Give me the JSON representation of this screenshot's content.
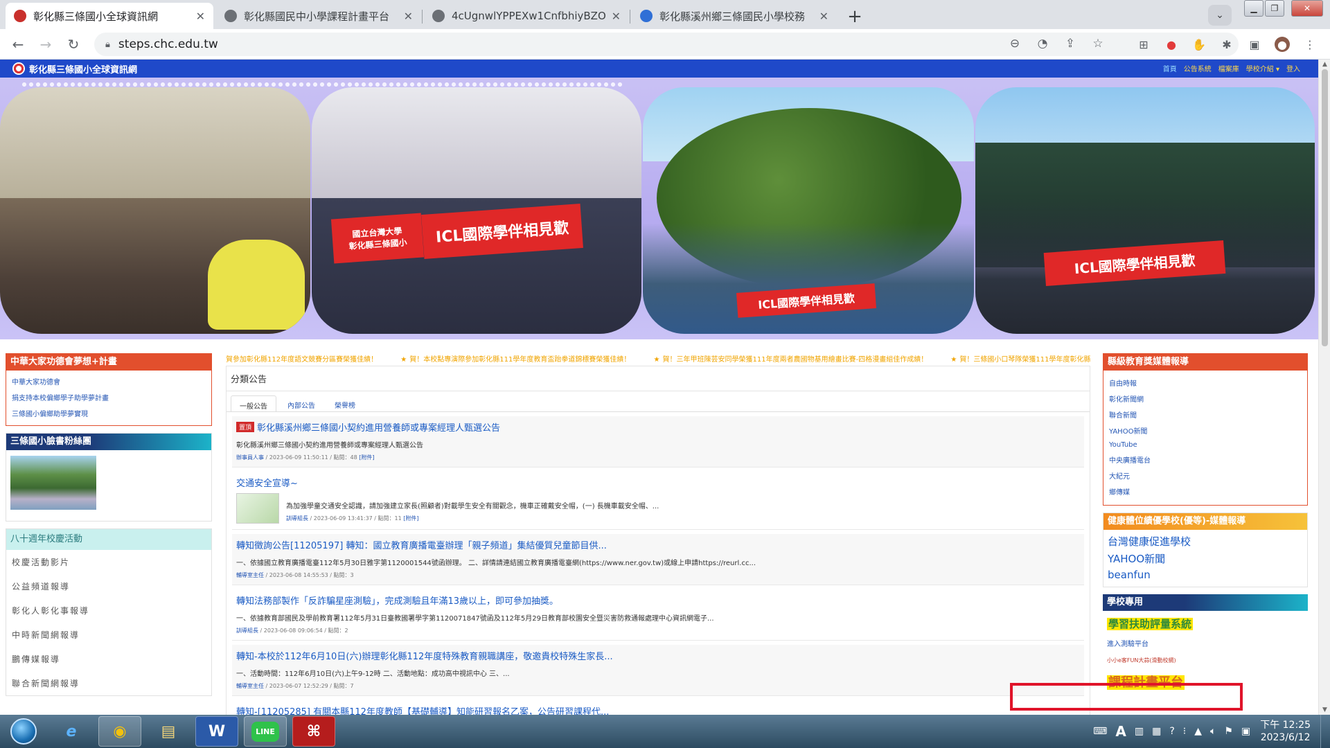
{
  "browser": {
    "tabs": [
      {
        "title": "彰化縣三條國小全球資訊網",
        "active": true,
        "favicon_color": "#c9302c"
      },
      {
        "title": "彰化縣國民中小學課程計畫平台",
        "active": false,
        "favicon_color": "#6b6f75"
      },
      {
        "title": "4cUgnwlYPPEXw1CnfbhiyBZO",
        "active": false,
        "favicon_color": "#6b6f75"
      },
      {
        "title": "彰化縣溪州鄉三條國民小學校務",
        "active": false,
        "favicon_color": "#2f6fd6"
      }
    ],
    "new_tab": "+",
    "url": "steps.chc.edu.tw"
  },
  "site": {
    "name": "彰化縣三條國小全球資訊網",
    "menu": [
      "首頁",
      "公告系統",
      "檔案庫",
      "學校介紹 ▾",
      "登入"
    ]
  },
  "banner": {
    "flag1_line1": "國立台灣大學",
    "flag1_line2": "彰化縣三條國小",
    "flag1_main": "ICL國際學伴相見歡",
    "flag2_main": "ICL國際學伴相見歡",
    "flag3_main": "ICL國際學伴相見歡"
  },
  "left": {
    "box1": {
      "title": "中華大家功德會夢想+計畫",
      "items": [
        "中華大家功德會",
        "捐支持本校偏鄉學子助學夢計畫",
        "三條國小偏鄉助學夢實現"
      ]
    },
    "box2": {
      "title": "三條國小臉書粉絲團"
    },
    "box3": {
      "title": "八十週年校慶活動",
      "items": [
        "校慶活動影片",
        "公益頻道報導",
        "彰化人彰化事報導",
        "中時新聞網報導",
        "鵬傳媒報導",
        "聯合新聞網報導"
      ]
    }
  },
  "ticker": [
    "賀參加彰化縣112年度語文競賽分區賽榮獲佳績！",
    "賀！本校點專演際參加彰化縣111學年度教育盃跆拳道錦標賽榮獲佳績！",
    "賀！三年甲班陳芸安同學榮獲111年度兩者農國物基用繪畫比賽-四格漫畫組佳作成績！",
    "賀！三條國小口琴隊榮獲111學年度彰化縣音樂比"
  ],
  "main": {
    "title": "分類公告",
    "tabs": [
      "一般公告",
      "內部公告",
      "榮譽榜"
    ],
    "posts": [
      {
        "badge": "置頂",
        "title": "彰化縣溪州鄉三條國小契約進用營養師或專案經理人甄選公告",
        "desc": "彰化縣溪州鄉三條國小契約進用營養師或專案經理人甄選公告",
        "unit": "辦事員人事",
        "meta": " / 2023-06-09 11:50:11 / 點閱：48 ",
        "attach": "[附件]"
      },
      {
        "badge": "",
        "title": "交通安全宣導~",
        "desc": "為加強學童交通安全認識，請加強建立家長(照顧者)對載學生安全有關觀念，機車正確戴安全帽，(一) 長機車載安全帽、...",
        "unit": "訓導組長",
        "meta": " / 2023-06-09 13:41:37 / 點閱：11 ",
        "attach": "[附件]"
      },
      {
        "badge": "",
        "title": "轉知徵詢公告[11205197] 轉知：國立教育廣播電臺辦理「親子頻道」集結優質兒童節目供...",
        "desc": "一、依據國立教育廣播電臺112年5月30日雅字第1120001544號函辦理。 二、詳情請連結國立教育廣播電臺網(https://www.ner.gov.tw)或線上申請https://reurl.cc...",
        "unit": "輔導室主任",
        "meta": " / 2023-06-08 14:55:53 / 點閱：3",
        "attach": ""
      },
      {
        "badge": "",
        "title": "轉知法務部製作「反詐騙星座測驗」，完成測驗且年滿13歲以上，即可參加抽獎。",
        "desc": "一、依據教育部國民及學前教育署112年5月31日臺教國署學字第1120071847號函及112年5月29日教育部校園安全暨災害防救通報處理中心資訊網電子...",
        "unit": "訓導組長",
        "meta": " / 2023-06-08 09:06:54 / 點閱：2",
        "attach": ""
      },
      {
        "badge": "",
        "title": "轉知-本校於112年6月10日(六)辦理彰化縣112年度特殊教育親職講座，敬邀貴校特殊生家長...",
        "desc": "一、活動時間：112年6月10日(六)上午9-12時 二、活動地點：成功高中視訊中心 三、...",
        "unit": "輔導室主任",
        "meta": " / 2023-06-07 12:52:29 / 點閱：7",
        "attach": ""
      },
      {
        "badge": "",
        "title": "轉知-[11205285] 有關本縣112年度教師【基礎輔導】知能研習報名乙案，公告研習課程代...",
        "desc": "",
        "unit": "",
        "meta": "",
        "attach": ""
      }
    ]
  },
  "right": {
    "box1": {
      "title": "縣級教育獎媒體報導",
      "items": [
        "自由時報",
        "彰化新聞網",
        "聯合新聞",
        "YAHOO新聞",
        "YouTube",
        "中央廣播電台",
        "大紀元",
        "鄉傳媒"
      ]
    },
    "box2": {
      "title": "健康體位績優學校(優等)-媒體報導",
      "items": [
        "台灣健康促進學校",
        "YAHOO新聞",
        "beanfun"
      ]
    },
    "box3": {
      "title": "學校專用",
      "learning": "學習扶助評量系統",
      "test": "進入測驗平台",
      "fun": "小小e客FUN大蒜(滑動校網)",
      "plan": "課程計畫平台"
    }
  },
  "taskbar": {
    "apps": [
      "e",
      "◉",
      "▤",
      "W",
      "LINE",
      "⌘"
    ],
    "ime": "A",
    "time": "下午 12:25",
    "date": "2023/6/12"
  }
}
